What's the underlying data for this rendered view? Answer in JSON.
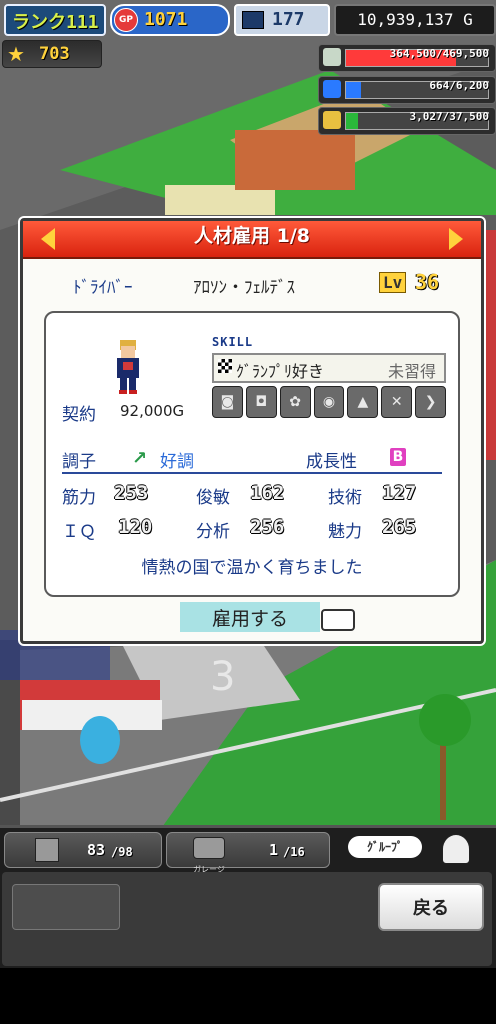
{
  "hud": {
    "rank_label": "ランク111",
    "gp_icon": "GP",
    "gp": "1071",
    "pc": "177",
    "money": "10,939,137 G",
    "stars": "703"
  },
  "resources": [
    {
      "icon": "fuel-barrel-icon",
      "text": "364,500/469,500",
      "fill": 0.776,
      "color": "#ff3a3a"
    },
    {
      "icon": "oil-can-icon",
      "text": "664/6,200",
      "fill": 0.107,
      "color": "#2a7aff"
    },
    {
      "icon": "wheat-icon",
      "text": "3,027/37,500",
      "fill": 0.081,
      "color": "#2ab83a"
    }
  ],
  "dialog": {
    "title": "人材雇用 1/8",
    "job": "ﾄﾞﾗｲﾊﾞｰ",
    "name": "ｱﾛｿﾝ・ﾌｪﾙﾃﾞｽ",
    "lv_label": "Lv",
    "level": "36",
    "contract_label": "契約",
    "contract_value": "92,000G",
    "skill_label": "SKILL",
    "skill_name": "ｸﾞﾗﾝﾌﾟﾘ好き",
    "skill_status": "未習得",
    "condition_label": "調子",
    "condition_value": "好調",
    "growth_label": "成長性",
    "growth_grade": "B",
    "stats": [
      {
        "label": "筋力",
        "value": "253"
      },
      {
        "label": "俊敏",
        "value": "162"
      },
      {
        "label": "技術",
        "value": "127"
      },
      {
        "label": "ＩＱ",
        "value": "120"
      },
      {
        "label": "分析",
        "value": "256"
      },
      {
        "label": "魅力",
        "value": "265"
      }
    ],
    "description": "情熱の国で温かく育ちました",
    "hire_button": "雇用する"
  },
  "bottom": {
    "count1": "83",
    "count1_max": "/98",
    "garage_label": "ガレージ",
    "count2": "1",
    "count2_max": "/16",
    "group_label": "ｸﾞﾙｰﾌﾟ",
    "back_button": "戻る"
  }
}
